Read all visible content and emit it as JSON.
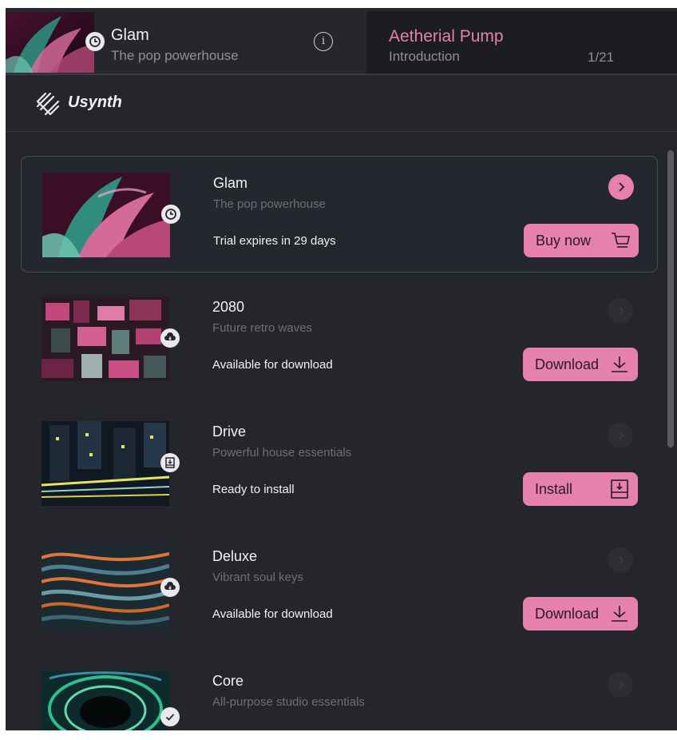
{
  "header": {
    "pack_title": "Glam",
    "pack_subtitle": "The pop powerhouse",
    "info_glyph": "i",
    "preset_name": "Aetherial Pump",
    "preset_category": "Introduction",
    "preset_count": "1/21"
  },
  "brand": {
    "name": "Usynth"
  },
  "colors": {
    "accent": "#e680ae",
    "background": "#24262c",
    "header_dark": "#1b1d22"
  },
  "packs": [
    {
      "title": "Glam",
      "subtitle": "The pop powerhouse",
      "status": "Trial expires in 29 days",
      "action": "Buy now",
      "action_icon": "cart-icon",
      "badge_icon": "clock-icon",
      "selected": true
    },
    {
      "title": "2080",
      "subtitle": "Future retro waves",
      "status": "Available for download",
      "action": "Download",
      "action_icon": "download-icon",
      "badge_icon": "cloud-download-icon"
    },
    {
      "title": "Drive",
      "subtitle": "Powerful house essentials",
      "status": "Ready to install",
      "action": "Install",
      "action_icon": "install-icon",
      "badge_icon": "install-icon"
    },
    {
      "title": "Deluxe",
      "subtitle": "Vibrant soul keys",
      "status": "Available for download",
      "action": "Download",
      "action_icon": "download-icon",
      "badge_icon": "cloud-download-icon"
    },
    {
      "title": "Core",
      "subtitle": "All-purpose studio essentials",
      "status": "",
      "action": "",
      "badge_icon": "check-icon"
    }
  ]
}
